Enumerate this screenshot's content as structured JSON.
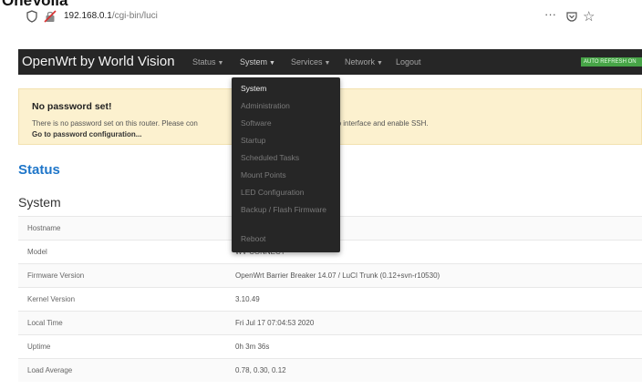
{
  "browser": {
    "url_host": "192.168.0.1",
    "url_path": "/cgi-bin/luci",
    "cutoff_title": "OneVoila",
    "more_label": "···"
  },
  "navbar": {
    "brand": "OpenWrt by World Vision",
    "items": [
      {
        "label": "Status"
      },
      {
        "label": "System"
      },
      {
        "label": "Services"
      },
      {
        "label": "Network"
      },
      {
        "label": "Logout"
      }
    ],
    "auto_refresh": "AUTO REFRESH ON"
  },
  "system_menu": {
    "items": [
      {
        "label": "System"
      },
      {
        "label": "Administration"
      },
      {
        "label": "Software"
      },
      {
        "label": "Startup"
      },
      {
        "label": "Scheduled Tasks"
      },
      {
        "label": "Mount Points"
      },
      {
        "label": "LED Configuration"
      },
      {
        "label": "Backup / Flash Firmware"
      },
      {
        "label": "Reboot"
      }
    ]
  },
  "alert": {
    "title": "No password set!",
    "text_left": "There is no password set on this router. Please con",
    "text_right": "tact the web interface and enable SSH.",
    "link": "Go to password configuration..."
  },
  "page": {
    "heading": "Status",
    "section": "System"
  },
  "system_table": {
    "rows": [
      {
        "key": "Hostname",
        "value": ""
      },
      {
        "key": "Model",
        "value": "WV-CONNECT"
      },
      {
        "key": "Firmware Version",
        "value": "OpenWrt Barrier Breaker 14.07 / LuCI Trunk (0.12+svn-r10530)"
      },
      {
        "key": "Kernel Version",
        "value": "3.10.49"
      },
      {
        "key": "Local Time",
        "value": "Fri Jul 17 07:04:53 2020"
      },
      {
        "key": "Uptime",
        "value": "0h 3m 36s"
      },
      {
        "key": "Load Average",
        "value": "0.78, 0.30, 0.12"
      }
    ]
  }
}
